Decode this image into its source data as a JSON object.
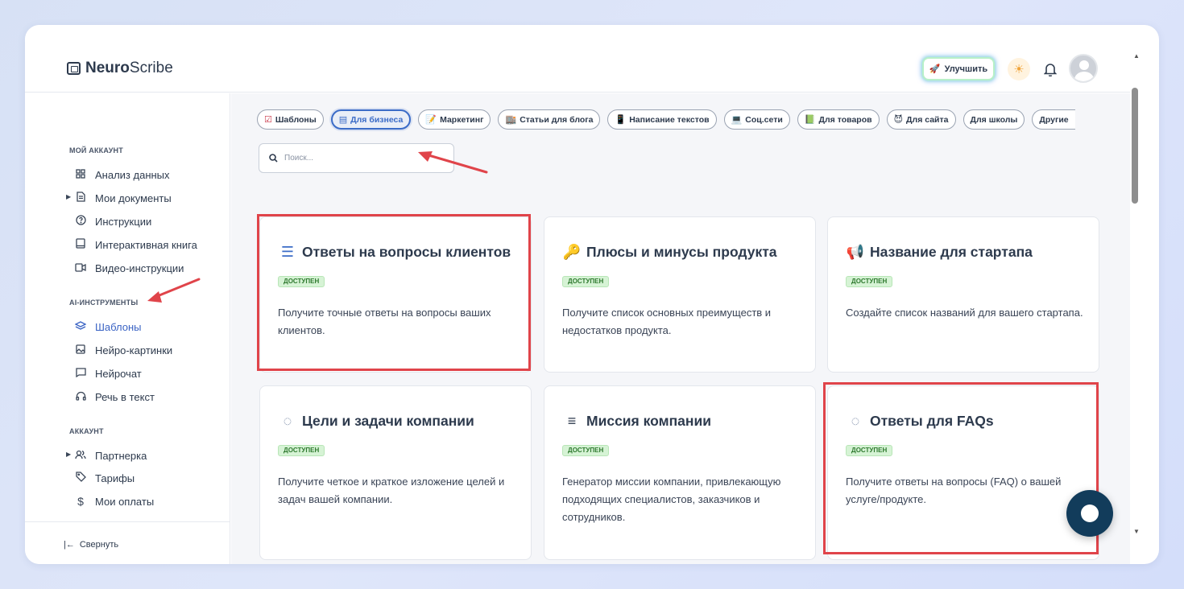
{
  "header": {
    "logo_bold": "Neuro",
    "logo_rest": "Scribe",
    "upgrade_label": "Улучшить"
  },
  "sidebar": {
    "sections": [
      {
        "title": "МОЙ АККАУНТ",
        "items": [
          {
            "label": "Анализ данных",
            "icon": "grid-icon"
          },
          {
            "label": "Мои документы",
            "icon": "document-icon"
          },
          {
            "label": "Инструкции",
            "icon": "help-circle-icon"
          },
          {
            "label": "Интерактивная книга",
            "icon": "book-icon"
          },
          {
            "label": "Видео-инструкции",
            "icon": "video-icon"
          }
        ]
      },
      {
        "title": "AI-ИНСТРУМЕНТЫ",
        "items": [
          {
            "label": "Шаблоны",
            "icon": "layers-icon"
          },
          {
            "label": "Нейро-картинки",
            "icon": "image-icon"
          },
          {
            "label": "Нейрочат",
            "icon": "chat-icon"
          },
          {
            "label": "Речь в текст",
            "icon": "headphones-icon"
          }
        ]
      },
      {
        "title": "АККАУНТ",
        "items": [
          {
            "label": "Партнерка",
            "icon": "users-icon"
          },
          {
            "label": "Тарифы",
            "icon": "tag-icon"
          },
          {
            "label": "Мои оплаты",
            "icon": "dollar-icon"
          }
        ]
      }
    ],
    "collapse_label": "Свернуть"
  },
  "categories": [
    {
      "label": "Шаблоны",
      "icon": "☑"
    },
    {
      "label": "Для бизнеса",
      "icon": "▤"
    },
    {
      "label": "Маркетинг",
      "icon": "📝"
    },
    {
      "label": "Статьи для блога",
      "icon": "🏬"
    },
    {
      "label": "Написание текстов",
      "icon": "📱"
    },
    {
      "label": "Соц.сети",
      "icon": "💻"
    },
    {
      "label": "Для товаров",
      "icon": "📗"
    },
    {
      "label": "Для сайта",
      "icon": "😈"
    },
    {
      "label": "Для школы",
      "icon": ""
    },
    {
      "label": "Другие",
      "icon": ""
    }
  ],
  "search": {
    "placeholder": "Поиск..."
  },
  "cards": [
    {
      "title": "Ответы на вопросы клиентов",
      "badge": "ДОСТУПЕН",
      "desc": "Получите точные ответы на вопросы ваших клиентов.",
      "icon": "☰"
    },
    {
      "title": "Плюсы и минусы продукта",
      "badge": "ДОСТУПЕН",
      "desc": "Получите список основных преимуществ и недостатков продукта.",
      "icon": "🔑"
    },
    {
      "title": "Название для стартапа",
      "badge": "ДОСТУПЕН",
      "desc": "Создайте список названий для вашего стартапа.",
      "icon": "📢"
    },
    {
      "title": "Цели и задачи компании",
      "badge": "ДОСТУПЕН",
      "desc": "Получите четкое и краткое изложение целей и задач вашей компании.",
      "icon": "◌"
    },
    {
      "title": "Миссия компании",
      "badge": "ДОСТУПЕН",
      "desc": "Генератор миссии компании, привлекающую подходящих специалистов, заказчиков и сотрудников.",
      "icon": "≡"
    },
    {
      "title": "Ответы для FAQs",
      "badge": "ДОСТУПЕН",
      "desc": "Получите ответы на вопросы (FAQ) о вашей услуге/продукте.",
      "icon": "◌"
    }
  ],
  "colors": {
    "accent": "#3b6cc7",
    "highlight": "#e0444a",
    "badge_bg": "#d6f3d5",
    "chat": "#123c5b"
  }
}
